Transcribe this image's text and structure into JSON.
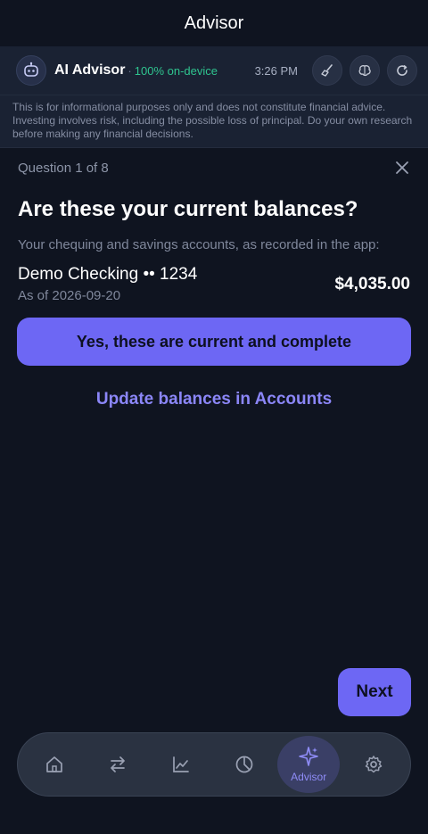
{
  "header": {
    "title": "Advisor"
  },
  "advisor": {
    "name": "AI Advisor",
    "separator": "·",
    "status": "100% on-device",
    "time": "3:26 PM"
  },
  "disclaimer": "This is for informational purposes only and does not constitute financial advice. Investing involves risk, including the possible loss of principal. Do your own research before making any financial decisions.",
  "question": {
    "counter": "Question 1 of 8",
    "title": "Are these your current balances?",
    "subtitle": "Your chequing and savings accounts, as recorded in the app:"
  },
  "account": {
    "name": "Demo Checking •• 1234",
    "as_of": "As of 2026-09-20",
    "balance": "$4,035.00"
  },
  "actions": {
    "confirm": "Yes, these are current and complete",
    "update": "Update balances in Accounts",
    "next": "Next"
  },
  "tabs": [
    {
      "icon": "home-icon",
      "label": ""
    },
    {
      "icon": "transfer-icon",
      "label": ""
    },
    {
      "icon": "trend-chart-icon",
      "label": ""
    },
    {
      "icon": "pie-chart-icon",
      "label": ""
    },
    {
      "icon": "sparkle-icon",
      "label": "Advisor"
    },
    {
      "icon": "gear-icon",
      "label": ""
    }
  ],
  "colors": {
    "background": "#0f1420",
    "accent": "#6d67f4",
    "status_green": "#2fc48f",
    "link": "#8b86f7"
  }
}
